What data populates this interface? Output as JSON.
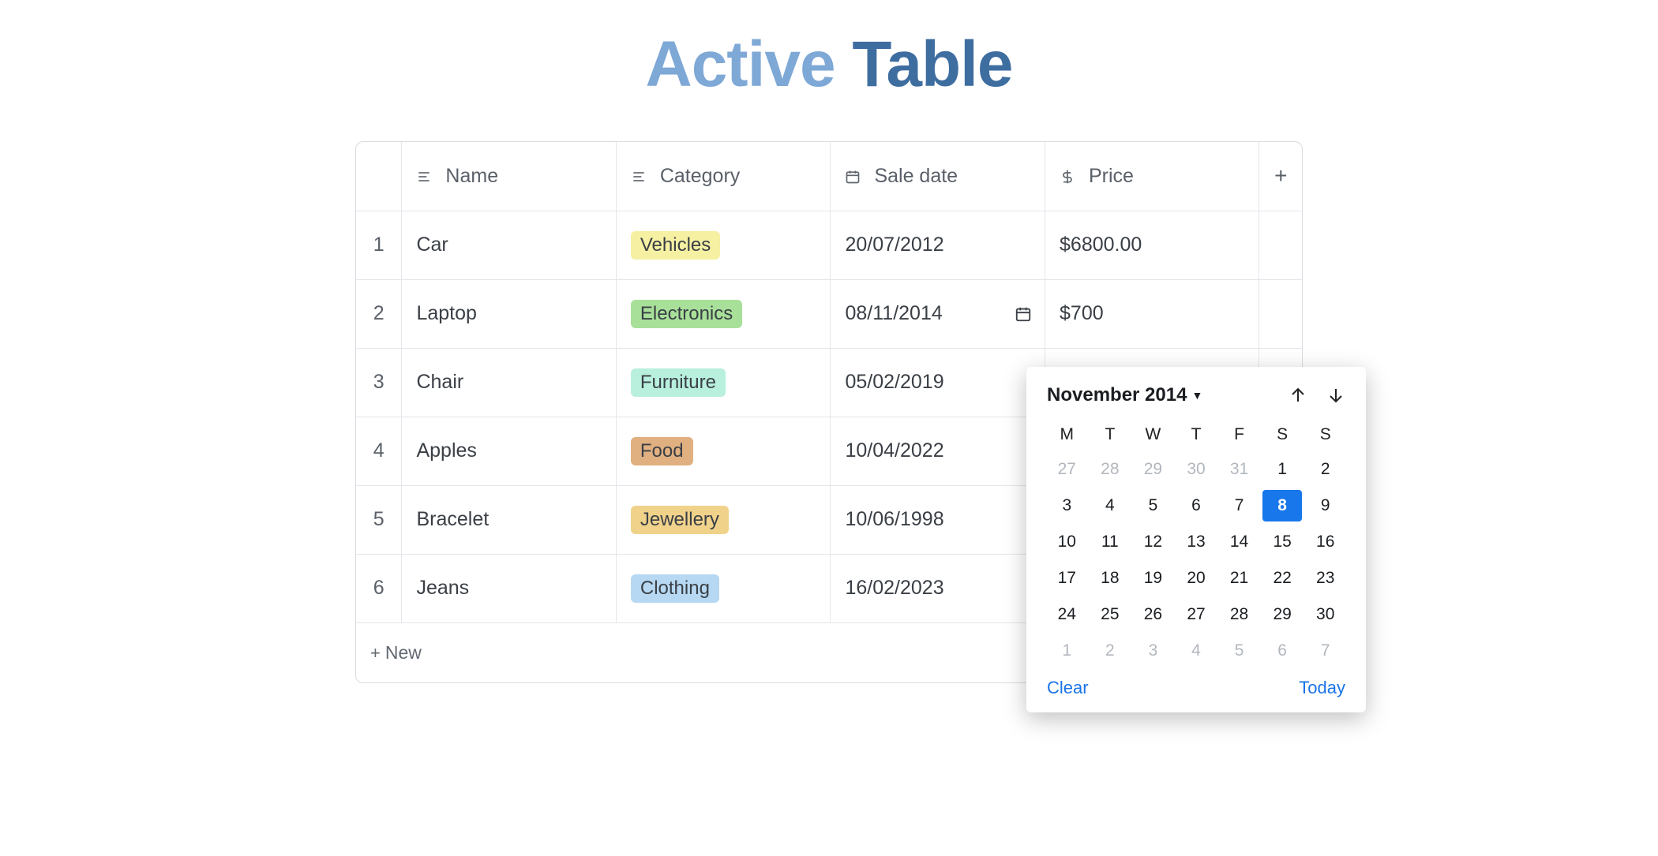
{
  "title": {
    "part1": "Active",
    "part2": "Table"
  },
  "columns": {
    "name": "Name",
    "category": "Category",
    "saleDate": "Sale date",
    "price": "Price",
    "add": "+"
  },
  "rows": [
    {
      "idx": "1",
      "name": "Car",
      "category": "Vehicles",
      "catClass": "vehicles",
      "date": "20/07/2012",
      "price": "$6800.00"
    },
    {
      "idx": "2",
      "name": "Laptop",
      "category": "Electronics",
      "catClass": "electronics",
      "date": "08/11/2014",
      "price": "$700",
      "editingDate": true
    },
    {
      "idx": "3",
      "name": "Chair",
      "category": "Furniture",
      "catClass": "furniture",
      "date": "05/02/2019",
      "price": ""
    },
    {
      "idx": "4",
      "name": "Apples",
      "category": "Food",
      "catClass": "food",
      "date": "10/04/2022",
      "price": ""
    },
    {
      "idx": "5",
      "name": "Bracelet",
      "category": "Jewellery",
      "catClass": "jewellery",
      "date": "10/06/1998",
      "price": ""
    },
    {
      "idx": "6",
      "name": "Jeans",
      "category": "Clothing",
      "catClass": "clothing",
      "date": "16/02/2023",
      "price": ""
    }
  ],
  "newRow": {
    "label": "New",
    "plus": "+"
  },
  "datepicker": {
    "title": "November 2014",
    "dow": [
      "M",
      "T",
      "W",
      "T",
      "F",
      "S",
      "S"
    ],
    "leading": [
      "27",
      "28",
      "29",
      "30",
      "31"
    ],
    "days": [
      "1",
      "2",
      "3",
      "4",
      "5",
      "6",
      "7",
      "8",
      "9",
      "10",
      "11",
      "12",
      "13",
      "14",
      "15",
      "16",
      "17",
      "18",
      "19",
      "20",
      "21",
      "22",
      "23",
      "24",
      "25",
      "26",
      "27",
      "28",
      "29",
      "30"
    ],
    "trailing": [
      "1",
      "2",
      "3",
      "4",
      "5",
      "6",
      "7"
    ],
    "selected": "8",
    "clear": "Clear",
    "today": "Today"
  }
}
